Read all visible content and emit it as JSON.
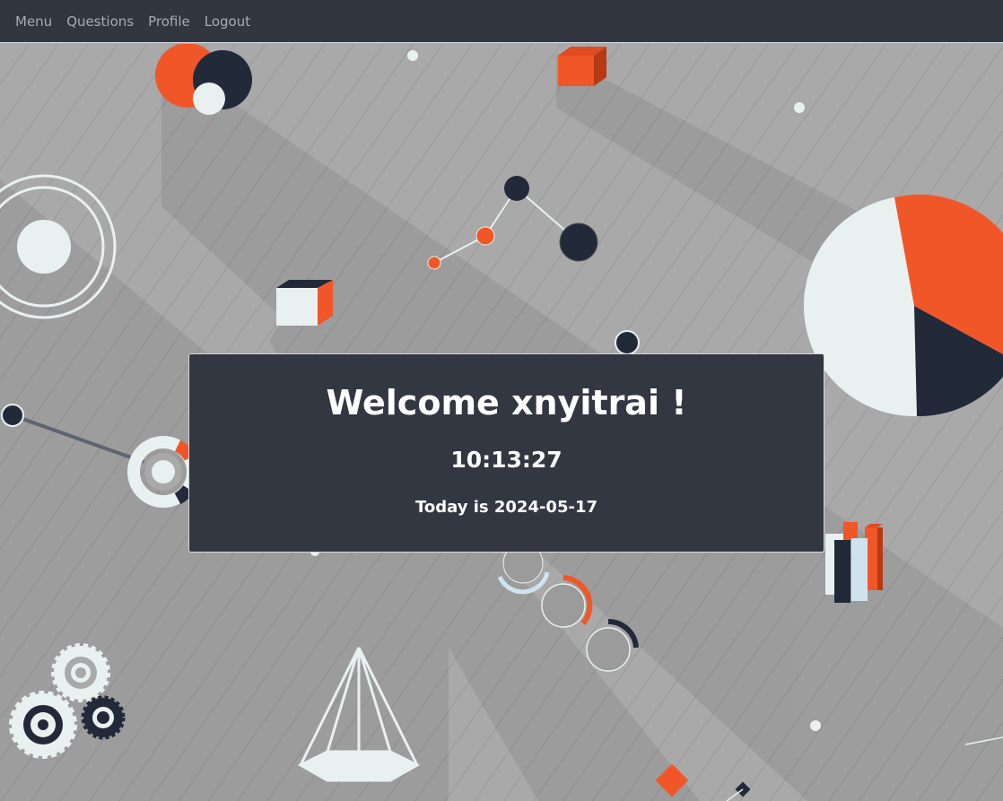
{
  "nav": {
    "items": [
      {
        "label": "Menu"
      },
      {
        "label": "Questions"
      },
      {
        "label": "Profile"
      },
      {
        "label": "Logout"
      }
    ]
  },
  "welcome": {
    "title": "Welcome xnyitrai !",
    "time": "10:13:27",
    "date_text": "Today is 2024-05-17"
  },
  "colors": {
    "navbar": "#323640",
    "card": "#333741",
    "accent_orange": "#f15628",
    "accent_navy": "#222a3a",
    "light": "#e8f1f0",
    "background": "#a9a9a9"
  }
}
